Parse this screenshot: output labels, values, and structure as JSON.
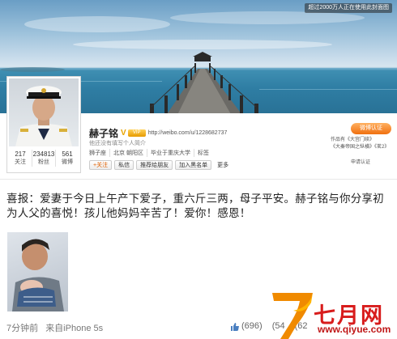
{
  "cover": {
    "banner": "超过2000万人正在使用此封面图"
  },
  "profile": {
    "name": "赫子铭",
    "v_mark": "V",
    "vip_badge": "VIP",
    "url": "http://weibo.com/u/1228682737",
    "description": "他还没有填写个人简介",
    "info": [
      "狮子座",
      "北京 朝阳区",
      "毕业于重庆大学",
      "标签"
    ],
    "buttons": {
      "follow": "+关注",
      "message": "私信",
      "recommend": "推荐给朋友",
      "blacklist": "加入黑名单",
      "more": "更多"
    },
    "stats": [
      {
        "value": "217",
        "label": "关注"
      },
      {
        "value": "234813",
        "label": "粉丝"
      },
      {
        "value": "561",
        "label": "微博"
      }
    ],
    "cert_button": "微博认证",
    "works": [
      "作品有《大宫门续》",
      "《大秦帝国之纵横》《茗2》"
    ],
    "apply": "申请认证"
  },
  "post": {
    "text": "喜报：爱妻于今日上午产下爱子，重六斤三两，母子平安。赫子铭与你分享初为人父的喜悦！孩儿他妈妈辛苦了！爱你！感恩！",
    "time": "7分钟前",
    "source": "来自iPhone 5s",
    "likes": "(696)",
    "reposts": "(54",
    "comments": "(62"
  },
  "watermark": {
    "title": "七月网",
    "url": "www.qiyue.com",
    "logo_char": "7"
  }
}
